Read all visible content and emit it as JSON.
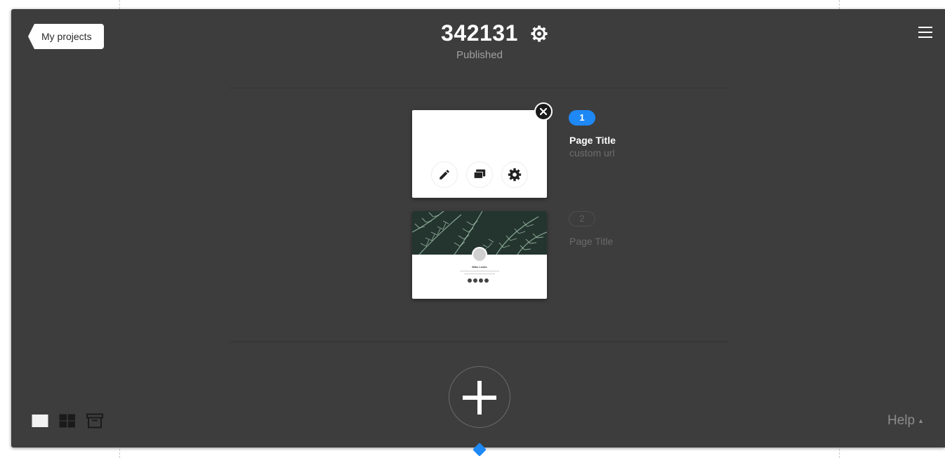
{
  "header": {
    "back_label": "My projects",
    "project_title": "342131",
    "status": "Published",
    "icons": {
      "title_settings": "gear-icon",
      "menu": "hamburger-menu-icon"
    }
  },
  "pages": [
    {
      "number": "1",
      "title": "Page Title",
      "url": "custom url",
      "active": true,
      "actions": [
        "pencil-icon",
        "layers-icon",
        "gear-icon"
      ],
      "remove_icon": "close-icon"
    },
    {
      "number": "2",
      "title": "Page Title",
      "active": false,
      "thumbnail": {
        "name": "Mike Leslie"
      }
    }
  ],
  "footer": {
    "add_icon": "plus-icon",
    "view_icons": [
      "single-view-icon",
      "grid-view-icon",
      "archive-icon"
    ],
    "help_label": "Help",
    "help_caret": "▲"
  },
  "colors": {
    "panel": "#3d3d3d",
    "accent": "#1e88f5",
    "text_primary": "#ffffff",
    "text_muted": "#a0a0a0"
  }
}
